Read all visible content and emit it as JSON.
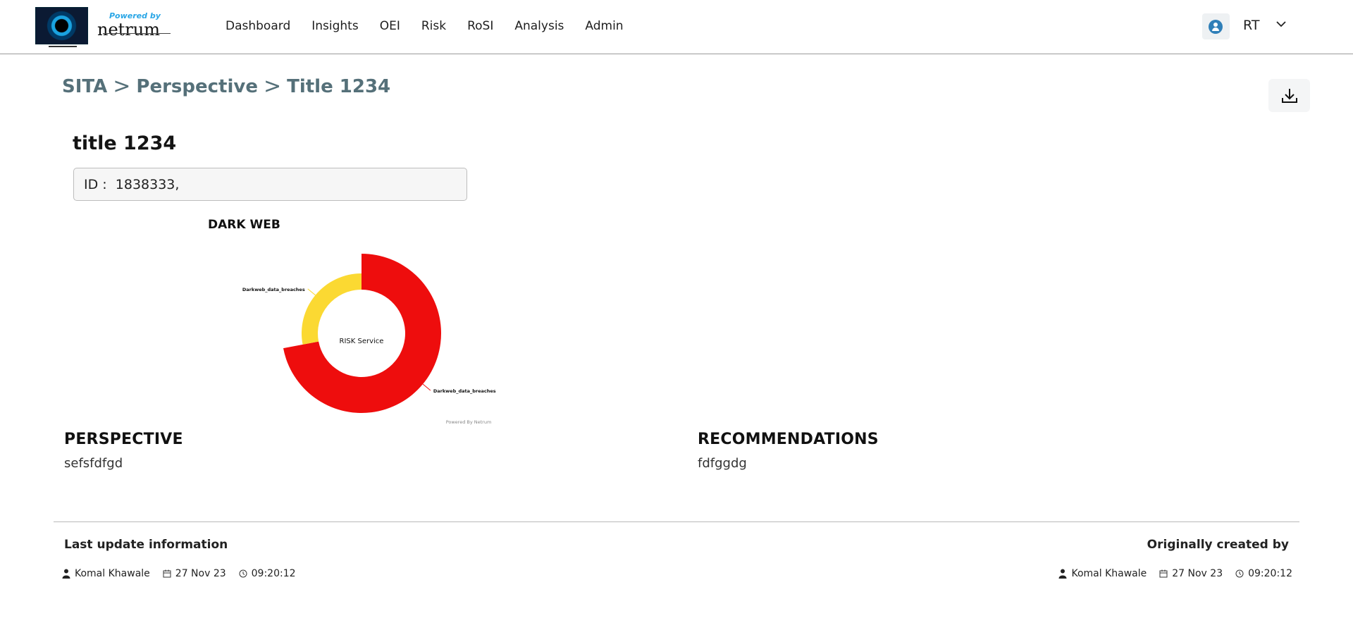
{
  "header": {
    "logo": {
      "powered_by": "Powered by",
      "brand": "netrum"
    },
    "nav": [
      "Dashboard",
      "Insights",
      "OEI",
      "Risk",
      "RoSI",
      "Analysis",
      "Admin"
    ],
    "user": {
      "initials": "RT",
      "icon": "user-circle-icon"
    }
  },
  "breadcrumb": [
    "SITA",
    "Perspective",
    "Title 1234"
  ],
  "breadcrumb_separator": ">",
  "toolbar": {
    "download_icon": "download-icon"
  },
  "record": {
    "title": "title 1234",
    "id_label": "ID :",
    "id_value": "1838333,"
  },
  "chart_data": {
    "type": "pie",
    "variant": "donut",
    "title": "DARK WEB",
    "center_label": "RISK Service",
    "slices": [
      {
        "label": "Darkweb_data_breaches",
        "value": 72,
        "color": "#ee0d0d"
      },
      {
        "label": "Darkweb_data_breaches",
        "value": 28,
        "color": "#fbd932"
      }
    ],
    "credit": "Powered By Netrum"
  },
  "perspective": {
    "heading": "PERSPECTIVE",
    "text": "sefsfdfgd"
  },
  "recommendations": {
    "heading": "RECOMMENDATIONS",
    "text": "fdfggdg"
  },
  "footer": {
    "last_update": {
      "label": "Last update information",
      "user": "Komal Khawale",
      "date": "27 Nov 23",
      "time": "09:20:12"
    },
    "created": {
      "label": "Originally created by",
      "user": "Komal Khawale",
      "date": "27 Nov 23",
      "time": "09:20:12"
    }
  }
}
